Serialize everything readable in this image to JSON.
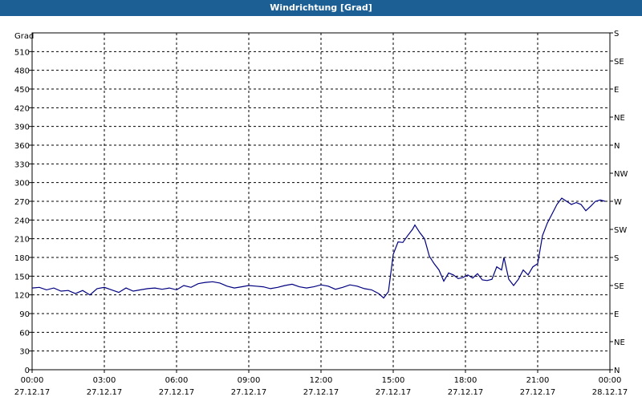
{
  "window": {
    "title": "Windrichtung [Grad]"
  },
  "chart_data": {
    "type": "line",
    "title": "Windrichtung [Grad]",
    "ylabel": "Grad",
    "xlabel": "",
    "ylim": [
      0,
      540
    ],
    "yticks": [
      0,
      30,
      60,
      90,
      120,
      150,
      180,
      210,
      240,
      270,
      300,
      330,
      360,
      390,
      420,
      450,
      480,
      510
    ],
    "xlim_hours": [
      0,
      24
    ],
    "xticks": [
      {
        "h": 0,
        "time": "00:00",
        "date": "27.12.17"
      },
      {
        "h": 3,
        "time": "03:00",
        "date": "27.12.17"
      },
      {
        "h": 6,
        "time": "06:00",
        "date": "27.12.17"
      },
      {
        "h": 9,
        "time": "09:00",
        "date": "27.12.17"
      },
      {
        "h": 12,
        "time": "12:00",
        "date": "27.12.17"
      },
      {
        "h": 15,
        "time": "15:00",
        "date": "27.12.17"
      },
      {
        "h": 18,
        "time": "18:00",
        "date": "27.12.17"
      },
      {
        "h": 21,
        "time": "21:00",
        "date": "27.12.17"
      },
      {
        "h": 24,
        "time": "00:00",
        "date": "28.12.17"
      }
    ],
    "right_axis": [
      {
        "v": 0,
        "label": "N"
      },
      {
        "v": 45,
        "label": "NE"
      },
      {
        "v": 90,
        "label": "E"
      },
      {
        "v": 135,
        "label": "SE"
      },
      {
        "v": 180,
        "label": "S"
      },
      {
        "v": 225,
        "label": "SW"
      },
      {
        "v": 270,
        "label": "W"
      },
      {
        "v": 315,
        "label": "NW"
      },
      {
        "v": 360,
        "label": "N"
      },
      {
        "v": 405,
        "label": "NE"
      },
      {
        "v": 450,
        "label": "E"
      },
      {
        "v": 495,
        "label": "SE"
      },
      {
        "v": 540,
        "label": "S"
      }
    ],
    "grid": true,
    "line_color": "#000080",
    "series": [
      {
        "x": [
          0,
          0.3,
          0.6,
          0.9,
          1.2,
          1.5,
          1.8,
          2.1,
          2.4,
          2.7,
          3.0,
          3.3,
          3.6,
          3.9,
          4.2,
          4.5,
          4.8,
          5.1,
          5.4,
          5.7,
          6.0,
          6.3,
          6.6,
          6.9,
          7.2,
          7.5,
          7.8,
          8.1,
          8.4,
          8.7,
          9.0,
          9.3,
          9.6,
          9.9,
          10.2,
          10.5,
          10.8,
          11.1,
          11.4,
          11.7,
          12.0,
          12.3,
          12.6,
          12.9,
          13.2,
          13.5,
          13.8,
          14.1,
          14.4,
          14.6,
          14.8,
          15.0,
          15.2,
          15.4,
          15.6,
          15.8,
          15.9,
          16.1,
          16.3,
          16.5,
          16.7,
          16.9,
          17.1,
          17.3,
          17.5,
          17.7,
          17.9,
          18.1,
          18.3,
          18.5,
          18.7,
          18.9,
          19.1,
          19.3,
          19.5,
          19.6,
          19.8,
          20.0,
          20.2,
          20.4,
          20.6,
          20.8,
          21.0,
          21.2,
          21.4,
          21.6,
          21.8,
          22.0,
          22.2,
          22.4,
          22.6,
          22.8,
          23.0,
          23.2,
          23.4,
          23.6,
          23.8
        ],
        "y": [
          131,
          132,
          128,
          131,
          126,
          127,
          122,
          127,
          120,
          130,
          132,
          128,
          124,
          131,
          126,
          128,
          130,
          131,
          129,
          131,
          128,
          135,
          132,
          138,
          140,
          141,
          139,
          134,
          131,
          133,
          135,
          134,
          133,
          130,
          132,
          135,
          137,
          133,
          131,
          133,
          136,
          134,
          129,
          132,
          136,
          134,
          130,
          128,
          122,
          115,
          125,
          185,
          205,
          204,
          215,
          225,
          232,
          220,
          210,
          182,
          170,
          160,
          142,
          155,
          152,
          146,
          148,
          152,
          147,
          154,
          144,
          143,
          145,
          165,
          160,
          180,
          145,
          135,
          145,
          160,
          152,
          165,
          170,
          215,
          235,
          250,
          265,
          275,
          270,
          265,
          268,
          265,
          255,
          262,
          270,
          272,
          270
        ]
      }
    ]
  }
}
